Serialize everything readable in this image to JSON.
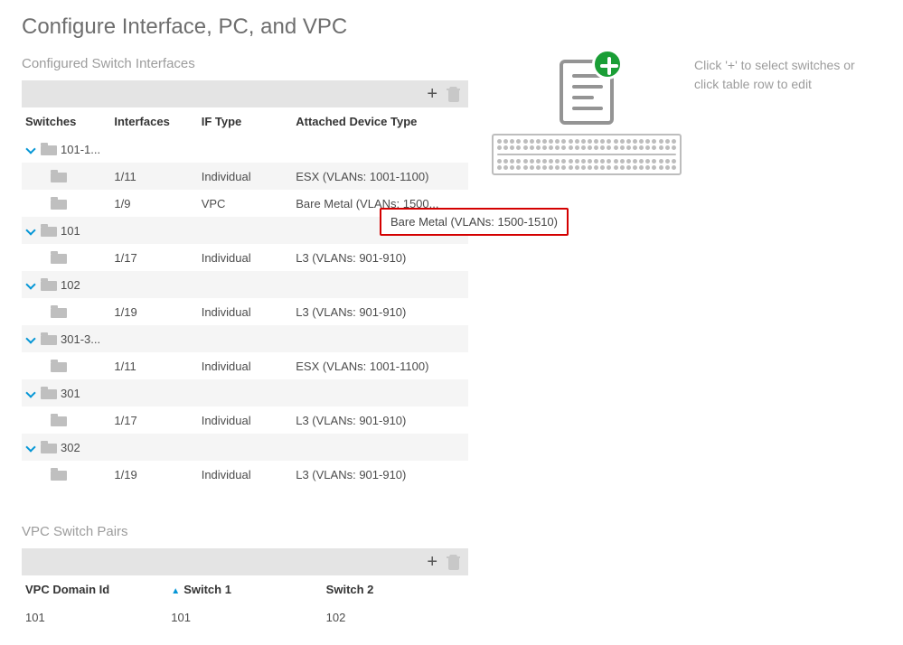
{
  "page": {
    "title": "Configure Interface, PC, and VPC"
  },
  "switch_interfaces": {
    "section_label": "Configured Switch Interfaces",
    "headers": {
      "switches": "Switches",
      "interfaces": "Interfaces",
      "if_type": "IF Type",
      "attached": "Attached Device Type"
    },
    "groups": [
      {
        "label": "101-1...",
        "children": [
          {
            "iface": "1/11",
            "iftype": "Individual",
            "device": "ESX (VLANs: 1001-1100)"
          },
          {
            "iface": "1/9",
            "iftype": "VPC",
            "device": "Bare Metal (VLANs: 1500..."
          }
        ]
      },
      {
        "label": "101",
        "children": [
          {
            "iface": "1/17",
            "iftype": "Individual",
            "device": "L3 (VLANs: 901-910)"
          }
        ]
      },
      {
        "label": "102",
        "children": [
          {
            "iface": "1/19",
            "iftype": "Individual",
            "device": "L3 (VLANs: 901-910)"
          }
        ]
      },
      {
        "label": "301-3...",
        "children": [
          {
            "iface": "1/11",
            "iftype": "Individual",
            "device": "ESX (VLANs: 1001-1100)"
          }
        ]
      },
      {
        "label": "301",
        "children": [
          {
            "iface": "1/17",
            "iftype": "Individual",
            "device": "L3 (VLANs: 901-910)"
          }
        ]
      },
      {
        "label": "302",
        "children": [
          {
            "iface": "1/19",
            "iftype": "Individual",
            "device": "L3 (VLANs: 901-910)"
          }
        ]
      }
    ],
    "tooltip": "Bare Metal (VLANs: 1500-1510)"
  },
  "vpc_pairs": {
    "section_label": "VPC Switch Pairs",
    "headers": {
      "domain": "VPC Domain Id",
      "s1": "Switch 1",
      "s2": "Switch 2"
    },
    "rows": [
      {
        "domain": "101",
        "s1": "101",
        "s2": "102"
      }
    ]
  },
  "help": {
    "line1": "Click '+' to select switches or",
    "line2": "click table row to edit"
  },
  "icons": {
    "plus": "+",
    "sort_asc": "▲"
  }
}
